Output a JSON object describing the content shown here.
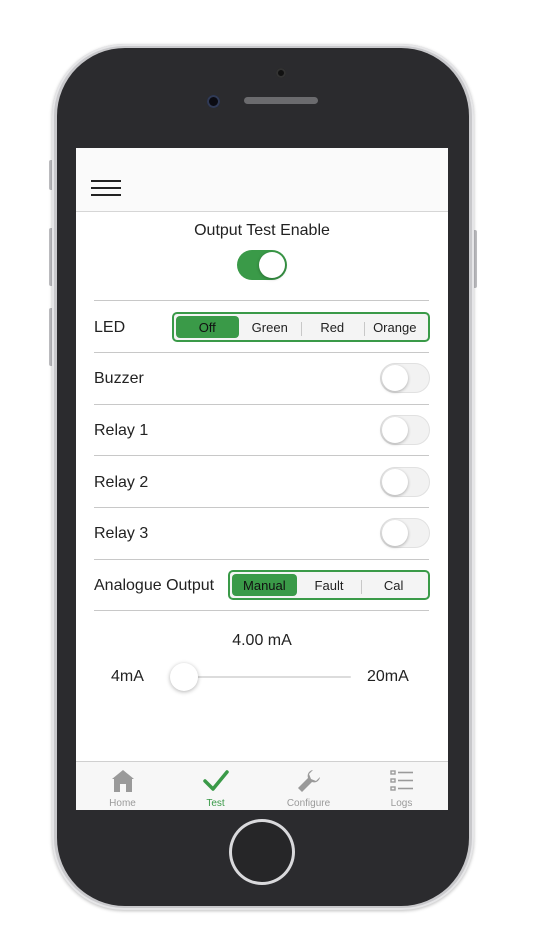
{
  "header": {
    "menu_icon": "hamburger-menu-icon"
  },
  "enable": {
    "label": "Output Test Enable",
    "on": true
  },
  "led": {
    "label": "LED",
    "options": [
      "Off",
      "Green",
      "Red",
      "Orange"
    ],
    "selected": "Off"
  },
  "toggles": [
    {
      "label": "Buzzer",
      "on": false
    },
    {
      "label": "Relay 1",
      "on": false
    },
    {
      "label": "Relay 2",
      "on": false
    },
    {
      "label": "Relay 3",
      "on": false
    }
  ],
  "analogue": {
    "label": "Analogue Output",
    "options": [
      "Manual",
      "Fault",
      "Cal"
    ],
    "selected": "Manual"
  },
  "slider": {
    "value_text": "4.00 mA",
    "min_label": "4mA",
    "max_label": "20mA",
    "fraction": 0
  },
  "tabs": [
    {
      "label": "Home",
      "icon": "home-icon",
      "active": false
    },
    {
      "label": "Test",
      "icon": "checkmark-icon",
      "active": true
    },
    {
      "label": "Configure",
      "icon": "wrench-icon",
      "active": false
    },
    {
      "label": "Logs",
      "icon": "list-icon",
      "active": false
    }
  ],
  "colors": {
    "accent": "#3a9a48",
    "inactive_tab": "#9a9a9a"
  }
}
